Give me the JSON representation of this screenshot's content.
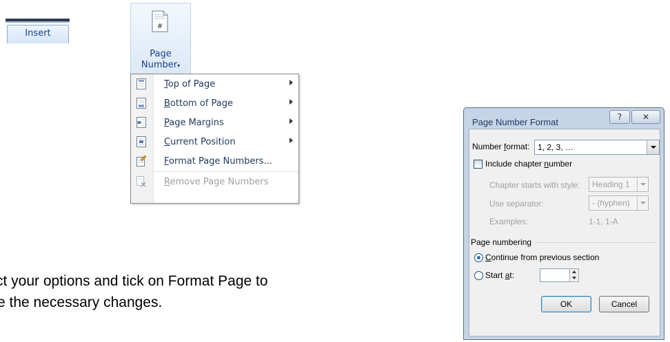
{
  "ribbon": {
    "tab_label": "Insert",
    "page_number_label_line1": "Page",
    "page_number_label_line2": "Number",
    "dropdown_arrow": "▾"
  },
  "menu": {
    "items": [
      {
        "label": "Top of Page",
        "mnemonic": "T",
        "rest": "op of Page",
        "icon": "page-top-icon",
        "submenu": true,
        "disabled": false
      },
      {
        "label": "Bottom of Page",
        "mnemonic": "B",
        "rest": "ottom of Page",
        "icon": "page-bottom-icon",
        "submenu": true,
        "disabled": false
      },
      {
        "label": "Page Margins",
        "mnemonic": "P",
        "rest": "age Margins",
        "icon": "page-margins-icon",
        "submenu": true,
        "disabled": false
      },
      {
        "label": "Current Position",
        "mnemonic": "C",
        "rest": "urrent Position",
        "icon": "current-position-icon",
        "submenu": true,
        "disabled": false
      },
      {
        "label": "Format Page Numbers...",
        "mnemonic": "F",
        "rest": "ormat Page Numbers...",
        "icon": "format-page-numbers-icon",
        "submenu": false,
        "disabled": false
      },
      {
        "label": "Remove Page Numbers",
        "mnemonic": "R",
        "rest": "emove Page Numbers",
        "icon": "remove-page-numbers-icon",
        "submenu": false,
        "disabled": true
      }
    ]
  },
  "instructions": {
    "line1": "ct your options and tick on Format Page to",
    "line2": "e the necessary changes."
  },
  "dialog": {
    "title": "Page Number Format",
    "help_glyph": "?",
    "close_glyph": "✕",
    "number_format_label_pre": "Number ",
    "number_format_label_u": "f",
    "number_format_label_post": "ormat:",
    "number_format_value": "1, 2, 3, …",
    "include_chapter_pre": "Include chapter ",
    "include_chapter_u": "n",
    "include_chapter_post": "umber",
    "include_chapter_checked": false,
    "chapter_style_label": "Chapter starts with style:",
    "chapter_style_value": "Heading 1",
    "separator_label": "Use separator:",
    "separator_value": "-  (hyphen)",
    "examples_label": "Examples:",
    "examples_value": "1-1, 1-A",
    "page_numbering_label": "Page numbering",
    "continue_u": "C",
    "continue_post": "ontinue from previous section",
    "continue_selected": true,
    "start_at_pre": "Start ",
    "start_at_u": "a",
    "start_at_post": "t:",
    "start_at_value": "",
    "ok_label": "OK",
    "cancel_label": "Cancel"
  },
  "colors": {
    "menu_text": "#1e395b",
    "disabled_text": "#a0a0a0",
    "ribbon_text": "#15428b"
  }
}
